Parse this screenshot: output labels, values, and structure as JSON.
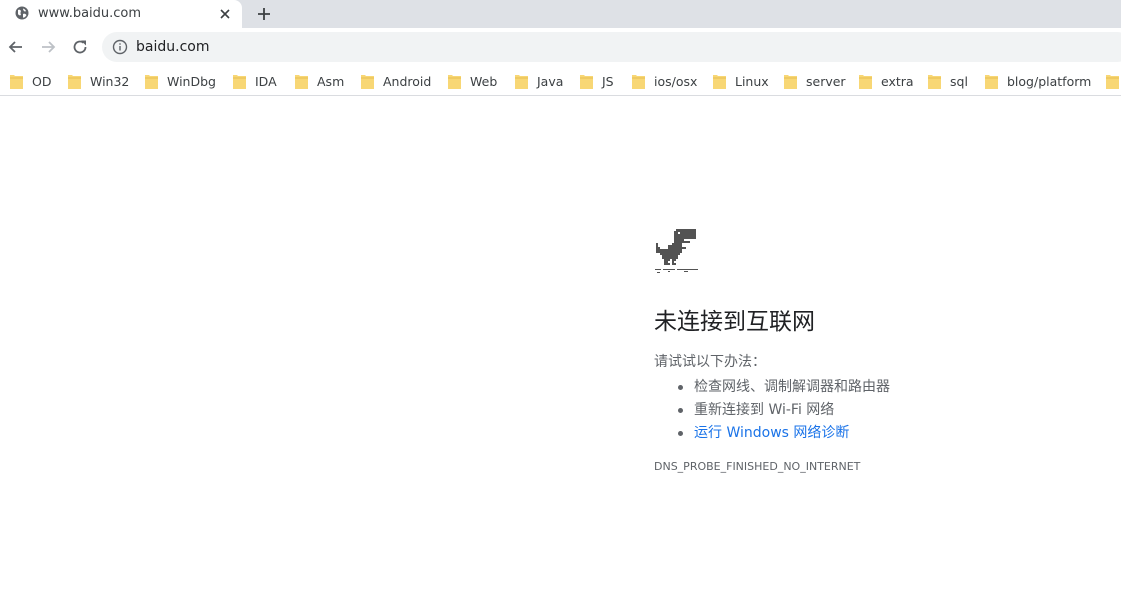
{
  "tab": {
    "title": "www.baidu.com"
  },
  "omnibox": {
    "url": "baidu.com"
  },
  "bookmarks": [
    {
      "label": "OD"
    },
    {
      "label": "Win32"
    },
    {
      "label": "WinDbg"
    },
    {
      "label": "IDA"
    },
    {
      "label": "Asm"
    },
    {
      "label": "Android"
    },
    {
      "label": "Web"
    },
    {
      "label": "Java"
    },
    {
      "label": "JS"
    },
    {
      "label": "ios/osx"
    },
    {
      "label": "Linux"
    },
    {
      "label": "server"
    },
    {
      "label": "extra"
    },
    {
      "label": "sql"
    },
    {
      "label": "blog/platform"
    }
  ],
  "error_page": {
    "title": "未连接到互联网",
    "suggestion_heading": "请试试以下办法：",
    "suggestions": [
      "检查网线、调制解调器和路由器",
      "重新连接到 Wi-Fi 网络",
      "运行 Windows 网络诊断"
    ],
    "error_code": "DNS_PROBE_FINISHED_NO_INTERNET"
  },
  "colors": {
    "tabstrip_bg": "#dee1e6",
    "omnibox_bg": "#f1f3f4",
    "link": "#1a73e8",
    "folder": "#f8d775"
  },
  "icons": {
    "favicon": "globe-icon",
    "close": "close-icon",
    "new_tab": "plus-icon",
    "back": "arrow-left-icon",
    "forward": "arrow-right-icon",
    "reload": "reload-icon",
    "site_info": "info-icon",
    "bookmark": "folder-icon",
    "error": "dinosaur-icon"
  }
}
